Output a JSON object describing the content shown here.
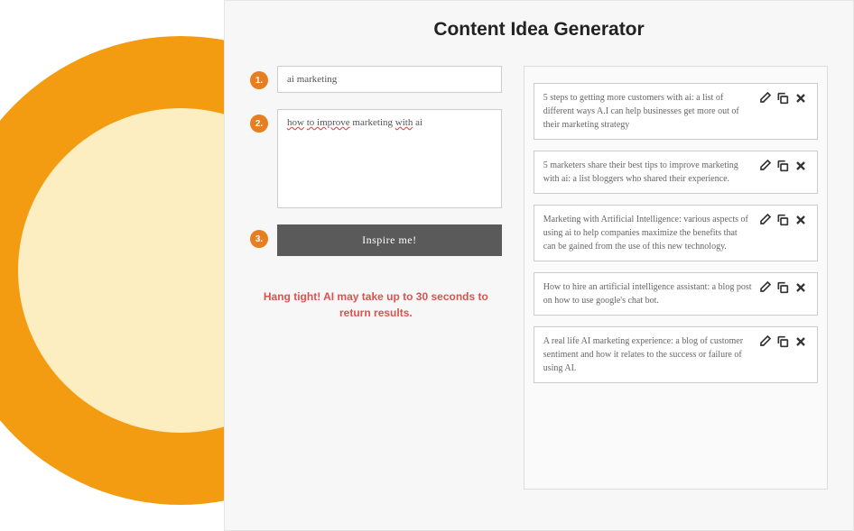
{
  "title": "Content Idea Generator",
  "steps": {
    "badge1": "1.",
    "badge2": "2.",
    "badge3": "3.",
    "input1_value": "ai marketing",
    "input2_value": "how to improve marketing with ai",
    "inspire_label": "Inspire me!"
  },
  "status": "Hang tight! AI may take up to 30 seconds to return results.",
  "results": [
    {
      "text": "5 steps to getting more customers with ai: a list of different ways A.I can help businesses get more out of their marketing strategy"
    },
    {
      "text": "5 marketers share their best tips to improve marketing with ai: a list bloggers who shared their experience."
    },
    {
      "text": "Marketing with Artificial Intelligence: various aspects of using ai to help companies maximize the benefits that can be gained from the use of this new technology."
    },
    {
      "text": "How to hire an artificial intelligence assistant: a blog post on how to use google's chat bot."
    },
    {
      "text": "A real life AI marketing experience: a blog of customer sentiment and how it relates to the success or failure of using AI."
    }
  ]
}
